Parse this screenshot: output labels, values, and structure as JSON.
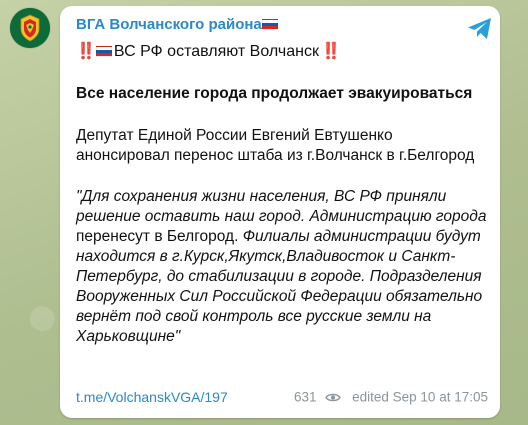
{
  "channel": {
    "name": "ВГА Волчанского района",
    "avatar_icon": "coat-of-arms-avatar-icon",
    "flag_icon": "russian-flag-icon"
  },
  "message": {
    "headline_prefix": "‼️",
    "headline_text": "ВС РФ оставляют Волчанск",
    "headline_suffix": "‼️",
    "bold_line": "Все население города продолжает эвакуироваться",
    "paragraph": "Депутат Единой России Евгений Евтушенко анонсировал перенос штаба из г.Волчанск в г.Белгород",
    "quote_part1": "\"Для сохранения жизни населения, ВС РФ приняли решение оставить наш город. Администрацию города ",
    "quote_upright1": "перенесут в Белгород.",
    "quote_part2": " Филиалы администрации будут находится в г.Курск,Якутск,Владивосток и Санкт-Петербург, до стабилизации в городе. Подразделения Вооруженных Сил Российской Федерации обязательно вернёт под свой контроль все русские земли на Харьковщине\""
  },
  "footer": {
    "link": "t.me/VolchanskVGA/197",
    "views": "631",
    "views_icon": "eye-icon",
    "edited_label": "edited",
    "timestamp": "Sep 10 at 17:05"
  },
  "actions": {
    "share_icon": "share-arrow-icon"
  },
  "colors": {
    "accent": "#2a8ac9",
    "bubble": "#ffffff",
    "wallpaper": "#b7c59a",
    "meta": "#8b949b"
  }
}
